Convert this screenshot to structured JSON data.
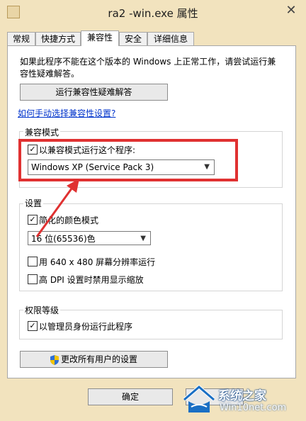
{
  "window": {
    "title": "ra2   -win.exe 属性",
    "close_glyph": "✕"
  },
  "tabs": [
    "常规",
    "快捷方式",
    "兼容性",
    "安全",
    "详细信息"
  ],
  "active_tab": "兼容性",
  "compat": {
    "intro_line1": "如果此程序不能在这个版本的 Windows 上正常工作，请尝试运行兼",
    "intro_line2": "容性疑难解答。",
    "troubleshoot_button": "运行兼容性疑难解答",
    "manual_link": "如何手动选择兼容性设置?"
  },
  "compat_mode": {
    "group_label": "兼容模式",
    "checkbox_label": "以兼容模式运行这个程序:",
    "checked": true,
    "os_selected": "Windows XP (Service Pack 3)"
  },
  "settings": {
    "group_label": "设置",
    "reduced_color_label": "简化的颜色模式",
    "reduced_color_checked": true,
    "color_selected": "16 位(65536)色",
    "res_640_label": "用 640 x 480 屏幕分辨率运行",
    "res_640_checked": false,
    "dpi_label": "高 DPI 设置时禁用显示缩放",
    "dpi_checked": false
  },
  "privilege": {
    "group_label": "权限等级",
    "admin_label": "以管理员身份运行此程序",
    "admin_checked": true
  },
  "all_users_button": "更改所有用户的设置",
  "footer": {
    "ok_button": "确定"
  },
  "watermark": {
    "line1": "系统之家",
    "line2": "Win10net.com"
  },
  "colors": {
    "annotation_red": "#e03131",
    "window_bg": "#f2e3be",
    "link_blue": "#0033cc"
  }
}
